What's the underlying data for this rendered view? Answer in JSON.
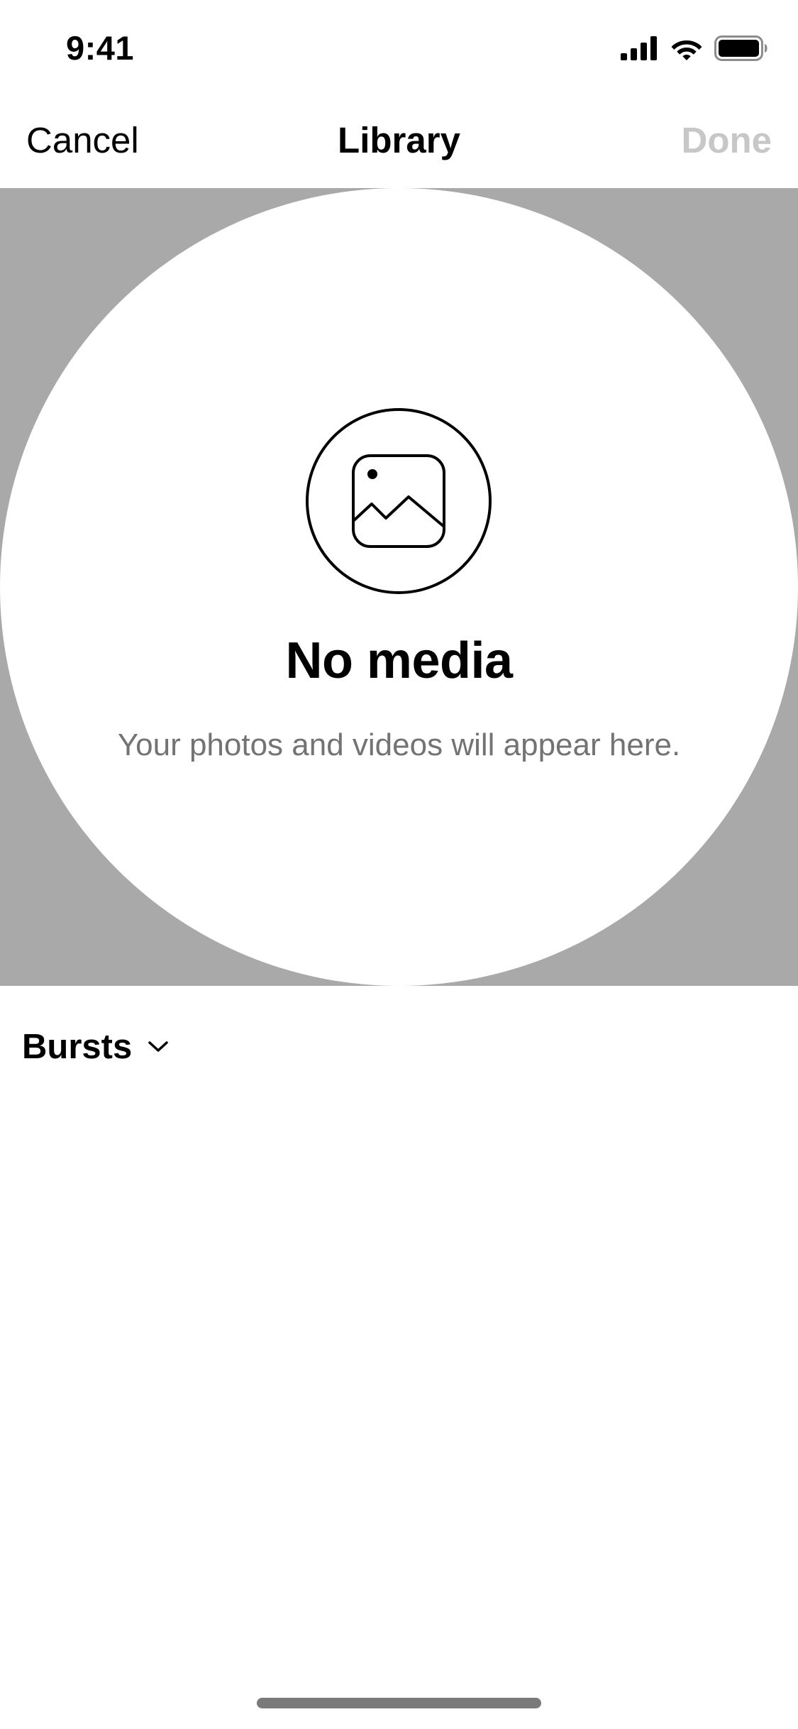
{
  "status_bar": {
    "time": "9:41",
    "icons": [
      "cellular-signal-icon",
      "wifi-icon",
      "battery-icon"
    ]
  },
  "nav": {
    "cancel_label": "Cancel",
    "title": "Library",
    "done_label": "Done",
    "done_enabled": false
  },
  "empty_state": {
    "icon": "photo-icon",
    "title": "No media",
    "subtitle": "Your photos and videos will appear here."
  },
  "album_selector": {
    "label": "Bursts",
    "icon": "chevron-down-icon"
  },
  "colors": {
    "preview_background": "#a9a9a9",
    "done_disabled": "#c7c7c7",
    "subtitle_text": "#737373",
    "home_indicator": "#7a7a7a"
  }
}
